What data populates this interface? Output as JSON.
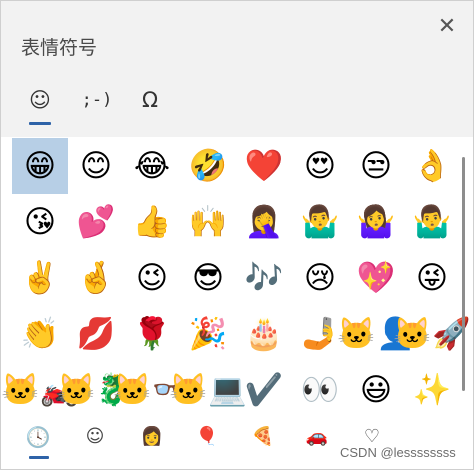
{
  "panel": {
    "title": "表情符号",
    "close_label": "✕"
  },
  "tabs": [
    {
      "id": "smiley",
      "label": "☺",
      "active": true
    },
    {
      "id": "kaomoji",
      "label": ";-)",
      "active": false
    },
    {
      "id": "symbols",
      "label": "Ω",
      "active": false
    }
  ],
  "emoji_rows": [
    [
      "😁",
      "😊",
      "😂",
      "🤣",
      "❤️",
      "😍",
      "😒",
      "👌"
    ],
    [
      "😘",
      "💕",
      "👍",
      "🙌",
      "🤦‍♀️",
      "🤷‍♂️",
      "🤷‍♀️",
      "🤷‍♂️"
    ],
    [
      "✌️",
      "🤞",
      "😉",
      "😎",
      "🎶",
      "😢",
      "💖",
      "😜"
    ],
    [
      "👏",
      "💋",
      "🌹",
      "🎉",
      "🎂",
      "🤳",
      "🐱‍👤",
      "🐱‍🚀"
    ],
    [
      "🐱‍🏍",
      "🐱‍🐉",
      "🐱‍👓",
      "🐱‍💻",
      "✔️",
      "👀",
      "😃",
      "✨"
    ]
  ],
  "selected_emoji": {
    "row": 0,
    "col": 0
  },
  "categories": [
    {
      "id": "recent",
      "icon": "clock-icon",
      "label": "🕓"
    },
    {
      "id": "people",
      "icon": "smiley-outline-icon",
      "label": "☺"
    },
    {
      "id": "person",
      "icon": "person-icon",
      "label": "👩"
    },
    {
      "id": "balloon",
      "icon": "balloon-icon",
      "label": "🎈"
    },
    {
      "id": "food",
      "icon": "pizza-icon",
      "label": "🍕"
    },
    {
      "id": "travel",
      "icon": "car-icon",
      "label": "🚗"
    },
    {
      "id": "symbols",
      "icon": "heart-outline-icon",
      "label": "♡"
    }
  ],
  "watermark": "CSDN @lessssssss",
  "colors": {
    "accent": "#2e63a8",
    "selected_bg": "#b7cfe6",
    "header_bg": "#f2f2f2"
  }
}
